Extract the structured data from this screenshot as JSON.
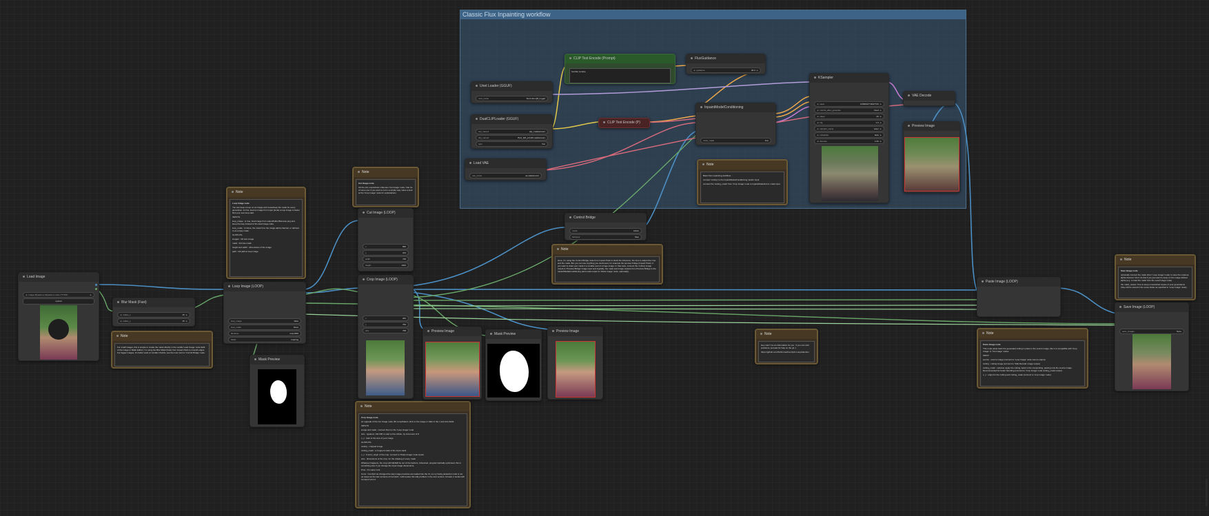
{
  "groups": {
    "inpainting": {
      "title": "Classic Flux Inpainting workflow"
    }
  },
  "nodes": {
    "load_image": {
      "title": "Load Image",
      "image_label": "image",
      "image_value": "dilyasimov-dilyasimov-rawn-777150...",
      "upload": "upload"
    },
    "blur_mask": {
      "title": "Blur Mask (Fast)",
      "radius_x_label": "radius_x",
      "radius_x": "15",
      "radius_y_label": "radius_y",
      "radius_y": "15"
    },
    "loop_image": {
      "title": "Loop Image (LOOP)",
      "w1_label": "loop_image",
      "w1_val": "false",
      "w2_label": "loop_mode",
      "w2_val": "None",
      "w3_label": "filename",
      "w3_val": "loop1000",
      "w4_label": "folder",
      "w4_val": "loopimg"
    },
    "mask_preview_left": {
      "title": "Mask Preview"
    },
    "cut_image": {
      "title": "Cut Image (LOOP)",
      "w1_label": "x",
      "w1_val": "896",
      "w2_label": "y",
      "w2_val": "224",
      "w3_label": "width",
      "w3_val": "736",
      "w4_label": "height",
      "w4_val": "1024"
    },
    "crop_image": {
      "title": "Crop Image (LOOP)",
      "w1_label": "x",
      "w1_val": "262",
      "w2_label": "y",
      "w2_val": "784",
      "w3_label": "size",
      "w3_val": "768"
    },
    "preview_image_1": {
      "title": "Preview Image"
    },
    "mask_preview_2": {
      "title": "Mask Preview"
    },
    "preview_image_2": {
      "title": "Preview Image"
    },
    "control_bridge": {
      "title": "Control Bridge",
      "w1_label": "mode",
      "w1_val": "Active",
      "w2_label": "behavior",
      "w2_val": "Stop"
    },
    "unet_loader": {
      "title": "Unet Loader (GGUF)",
      "w1_label": "unet_name",
      "w1_val": "flux1-dev-Q8_0.gguf"
    },
    "dualclip_loader": {
      "title": "DualCLIPLoader (GGUF)",
      "w1_label": "clip_name1",
      "w1_val": "clip_l.safetensors",
      "w2_label": "clip_name2",
      "w2_val": "t5xxl_fp8_e4m3fn.safetensors",
      "w3_label": "type",
      "w3_val": "flux"
    },
    "load_vae": {
      "title": "Load VAE",
      "w1_label": "vae_name",
      "w1_val": "ae.safetensors"
    },
    "clip_text_encode_pos": {
      "title": "CLIP Text Encode (Prompt)",
      "prompt": "horrible zombie"
    },
    "clip_text_encode_neg": {
      "title": "CLIP Text Encode (P)"
    },
    "flux_guidance": {
      "title": "FluxGuidance",
      "w1_label": "guidance",
      "w1_val": "30.0"
    },
    "inpaint_model_cond": {
      "title": "InpaintModelConditioning",
      "w1_label": "noise_mask",
      "w1_val": "true"
    },
    "ksampler": {
      "title": "KSampler",
      "w1_label": "seed",
      "w1_val": "1038332774047720",
      "w2_label": "control_after_generate",
      "w2_val": "fixed",
      "w3_label": "steps",
      "w3_val": "20",
      "w4_label": "cfg",
      "w4_val": "1.0",
      "w5_label": "sampler_name",
      "w5_val": "euler",
      "w6_label": "scheduler",
      "w6_val": "beta",
      "w7_label": "denoise",
      "w7_val": "1.00"
    },
    "vae_decode": {
      "title": "VAE Decode"
    },
    "preview_image_3": {
      "title": "Preview Image"
    },
    "paste_image": {
      "title": "Paste Image (LOOP)"
    },
    "save_image": {
      "title": "Save Image (LOOP)",
      "w1_label": "save_images",
      "w1_val": "None"
    }
  },
  "notes": {
    "loop_note": {
      "title": "Note",
      "heading": "Loop Image node",
      "body": "You can keep a loop on an image and reuse/keep the mask for every generation. At first, load an image from Input (local) a loop image to faster find your next loop start.",
      "inputs_title": "INPUTS",
      "outputs_title": "OUTPUTS",
      "items": [
        "loop_image : is true, load image from output/folder/filename.png and keep the loop instead of the load image node.",
        "loop_mode : is None, the mask from the image alpha channel, or defined to an empty mask.",
        "images : full size image",
        "mask : full size mask",
        "height and width : dimensions of the image",
        "path : full path to loop image"
      ]
    },
    "cut_note": {
      "title": "Note",
      "heading": "Cut Image node",
      "body": "Ok the old, unpractical, infamous 'Cut Image' node. Can be of some use if you want to cut in a simple way. Have a look at the 'Crop Image' node for explanations."
    },
    "crop_note": {
      "title": "Note",
      "heading": "Crop Image node",
      "body": "an upgrade of the Cut Image node. Bit complicated, click on the image or slide in the x and size fields.",
      "inputs_title": "INPUTS",
      "outputs_title": "OUTPUTS",
      "items": [
        "image and mask : connect them to the 'Loop Image' node",
        "size : squared, 102 000 to start to the infinite, by increment of 8",
        "x, y : start to the size of your image",
        "cutting : cropped image",
        "cutting_mask : a cropped mask of the input mask",
        "x, y : 0 and y origin of the crop, connect to 'Paste Image' node inputs",
        "size : dimensions of the crop, for the drawing of every mask"
      ],
      "extra": "Whatever happens, the crop will NEVER be out of the borders. Advanced, programmatically optimised, this is something else if you change the input image dimensions.",
      "pros": "Pros : It's super cool.",
      "cons": "Cons : ComfyUI as changed the way image previews are loaded into the UI, so my hacky javascript code is not as sweet as the last versions of ComfyUI. I will resolve this silly problem in the next version. At least, it works with ComfyUI v0.2.0."
    },
    "control_note": {
      "title": "Note",
      "body": "Here, I'm using the Control Bridge node from Impact Pack to block the inference, the time to adjust the crop and the mask. But you can use anything you want/need, for example the preview bridge (Impact Pack). If you want to draw your mask in a smaller part of a huge image. In that case, connect the 'cutting' image output to 'Preview Bridge' image input and logically, the mask and image outputs from Preview Bridge to the InpaintModelConditioning (and mask output to 'Paste Image' node, optionally)."
    },
    "blur_note": {
      "title": "Note",
      "body": "For small images, this is simple to create the mask directly in the vanilla 'Load Image' node (Edit of the image or Mask Editor). I'm using the Blur Mask (Fast) from Impact Pack to smooth edges. For bigger images, it's better work on smaller chunks, see the note next to 'Control Bridge' node."
    },
    "inpaint_note": {
      "title": "Note",
      "body": "Basic Flux inpainting workflow :",
      "items": [
        "connect 'cutting' to the InpaintModelConditioning 'pixels' input",
        "connect the 'cutting_mask' from 'Crop Image' node to InpaintModelCond. mask input"
      ]
    },
    "info_note": {
      "title": "Note",
      "body": "Hey man! I've an information for you : if you can visit problems, just ask for help on the git :)",
      "link": "https://github.com/Schimmel/ComfyUI-LoopAttention"
    },
    "paste_note": {
      "title": "Note",
      "heading": "Paste Image node",
      "body": "This node paste back the generated cutting in place in the source image, like it is compatible with 'Crop Image' or 'Cut Image' nodes.",
      "inputs_title": "INPUT",
      "items": [
        "source : source image (connect to 'Loop Image' node source output)",
        "cutting : cutting image (connect to 'VAE Decode' image output)",
        "cutting_mask : optional, apply the cutting mask in the compositing, pasting only the source image. Recommended for better blending (connect to 'Crop Image' node cutting_mask output)",
        "x, y : origin for the cutting and cutting_mask (connect to 'crop image' node)"
      ]
    },
    "save_note": {
      "title": "Note",
      "heading": "Save Image node",
      "items": [
        "optionally connect the mask (from 'Loop Image' node) to save the mask as alpha channel. Don't do this if you just want to keep on the image without alpha (e.g. to load the mask from the Load Image node).",
        "the mask_output: True to keep unrestricted copies of your generations (they will be saved in the same folder as specified in 'Loop Image' node)."
      ]
    }
  }
}
